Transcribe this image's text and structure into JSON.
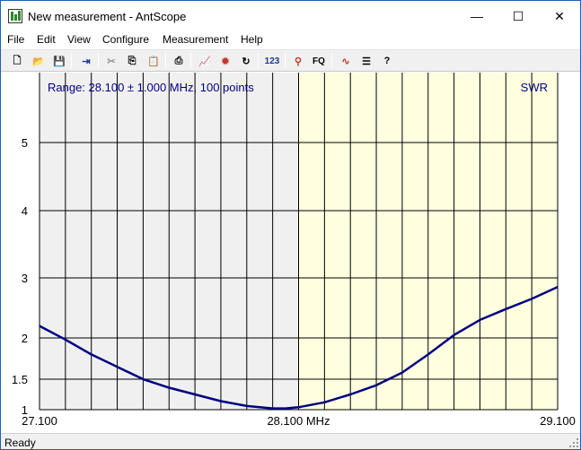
{
  "window": {
    "title": "New measurement - AntScope",
    "minimize_glyph": "—",
    "maximize_glyph": "☐",
    "close_glyph": "✕"
  },
  "menu": [
    "File",
    "Edit",
    "View",
    "Configure",
    "Measurement",
    "Help"
  ],
  "toolbar": {
    "buttons": [
      {
        "name": "new-file-icon",
        "glyph": "🗋"
      },
      {
        "name": "open-folder-icon",
        "glyph": "📂"
      },
      {
        "name": "save-icon",
        "glyph": "💾"
      },
      {
        "name": "export-icon",
        "glyph": "⇥"
      },
      {
        "name": "cut-icon",
        "glyph": "✂"
      },
      {
        "name": "copy-icon",
        "glyph": "⎘"
      },
      {
        "name": "paste-icon",
        "glyph": "📋"
      },
      {
        "name": "print-icon",
        "glyph": "⎙"
      },
      {
        "name": "chart-icon",
        "glyph": "📈"
      },
      {
        "name": "scan-icon",
        "glyph": "✹"
      },
      {
        "name": "repeat-icon",
        "glyph": "↻"
      },
      {
        "name": "numbers-icon",
        "glyph": "123"
      },
      {
        "name": "antenna-icon",
        "glyph": "⚲"
      },
      {
        "name": "frequency-icon",
        "glyph": "FQ"
      },
      {
        "name": "waveform-icon",
        "glyph": "∿"
      },
      {
        "name": "list-icon",
        "glyph": "☰"
      },
      {
        "name": "help-icon",
        "glyph": "?"
      }
    ]
  },
  "status": {
    "text": "Ready"
  },
  "colors": {
    "left_band": "#f0f0f0",
    "right_band": "#ffffe0",
    "curve": "#000080",
    "label": "#000080",
    "grid": "#000000"
  },
  "chart_data": {
    "type": "line",
    "range_text": "Range: 28.100 ± 1.000 MHz, 100 points",
    "mode_label": "SWR",
    "xlim": [
      27.1,
      29.1
    ],
    "x_ticks": [
      {
        "value": 27.1,
        "label": "27.100"
      },
      {
        "value": 28.1,
        "label": "28.100 MHz"
      },
      {
        "value": 29.1,
        "label": "29.100"
      }
    ],
    "y_ticks": [
      {
        "value": 1,
        "label": "1"
      },
      {
        "value": 1.5,
        "label": "1.5"
      },
      {
        "value": 2,
        "label": "2"
      },
      {
        "value": 3,
        "label": "3"
      },
      {
        "value": 4,
        "label": "4"
      },
      {
        "value": 5,
        "label": "5"
      }
    ],
    "vertical_grid_count": 20,
    "grid": true,
    "series": [
      {
        "x": [
          27.1,
          27.2,
          27.3,
          27.4,
          27.5,
          27.6,
          27.7,
          27.8,
          27.9,
          28.0,
          28.05,
          28.1,
          28.2,
          28.3,
          28.4,
          28.5,
          28.6,
          28.7,
          28.8,
          28.9,
          29.0,
          29.1
        ],
        "y": [
          2.2,
          1.98,
          1.8,
          1.65,
          1.5,
          1.36,
          1.25,
          1.14,
          1.06,
          1.02,
          1.02,
          1.04,
          1.12,
          1.25,
          1.4,
          1.58,
          1.8,
          2.05,
          2.3,
          2.48,
          2.65,
          2.85
        ]
      }
    ]
  }
}
